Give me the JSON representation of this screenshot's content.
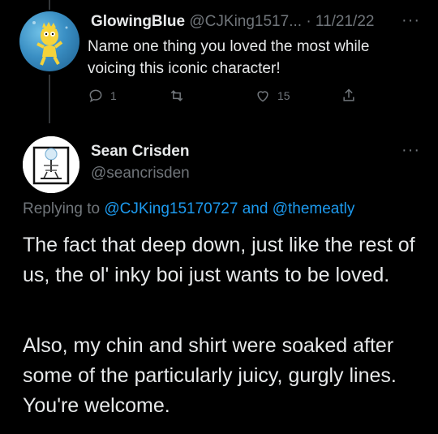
{
  "colors": {
    "background": "#000000",
    "text": "#e7e9ea",
    "muted": "#71767b",
    "link": "#1d9bf0"
  },
  "tweet1": {
    "display_name": "GlowingBlue",
    "handle": "@CJKing1517...",
    "separator": "·",
    "date": "11/21/22",
    "more_icon": "more-dots-icon",
    "text": "Name one thing you loved the most while voicing this iconic character!",
    "actions": {
      "reply_count": "1",
      "retweet_count": "",
      "like_count": "15",
      "share_count": ""
    }
  },
  "tweet2": {
    "display_name": "Sean Crisden",
    "handle": "@seancrisden",
    "replying_prefix": "Replying to",
    "mention1": "@CJKing15170727",
    "conjunction": "and",
    "mention2": "@themeatly",
    "paragraph1": "The fact that deep down, just like the rest of us, the ol' inky boi just wants to be loved.",
    "paragraph2": "Also, my chin and shirt were soaked after some of the particularly juicy, gurgly lines. You're welcome."
  }
}
